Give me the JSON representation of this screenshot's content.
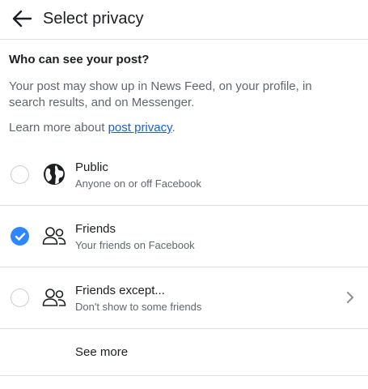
{
  "header": {
    "title": "Select privacy",
    "back_icon": "arrow-left-icon"
  },
  "intro": {
    "heading": "Who can see your post?",
    "description": "Your post may show up in News Feed, on your profile, in search results, and on Messenger.",
    "learn_more_prefix": "Learn more about ",
    "learn_more_link": "post privacy",
    "learn_more_suffix": "."
  },
  "options": [
    {
      "title": "Public",
      "subtitle": "Anyone on or off Facebook",
      "icon": "globe-icon",
      "selected": false,
      "has_chevron": false
    },
    {
      "title": "Friends",
      "subtitle": "Your friends on Facebook",
      "icon": "friends-icon",
      "selected": true,
      "has_chevron": false
    },
    {
      "title": "Friends except...",
      "subtitle": "Don't show to some friends",
      "icon": "friends-except-icon",
      "selected": false,
      "has_chevron": true
    }
  ],
  "see_more": {
    "label": "See more"
  },
  "colors": {
    "accent": "#2d88ff",
    "link": "#1a5fd1",
    "secondary_text": "#606770",
    "divider": "#dadde1"
  }
}
